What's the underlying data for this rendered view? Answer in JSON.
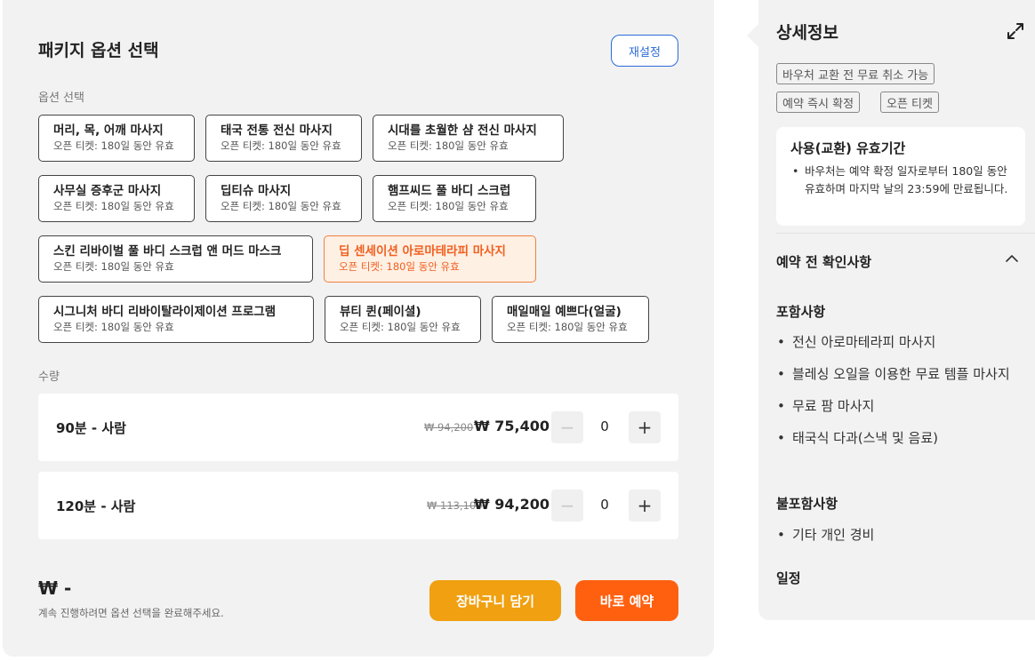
{
  "package": {
    "title": "패키지 옵션 선택",
    "reset_label": "재설정",
    "options_label": "옵션 선택",
    "options": [
      {
        "name": "머리, 목, 어깨 마사지",
        "sub": "오픈 티켓: 180일 동안 유효",
        "selected": false
      },
      {
        "name": "태국 전통 전신 마사지",
        "sub": "오픈 티켓: 180일 동안 유효",
        "selected": false
      },
      {
        "name": "시대를 초월한 샴 전신 마사지",
        "sub": "오픈 티켓: 180일 동안 유효",
        "selected": false
      },
      {
        "name": "사무실 증후군 마사지",
        "sub": "오픈 티켓: 180일 동안 유효",
        "selected": false
      },
      {
        "name": "딥티슈 마사지",
        "sub": "오픈 티켓: 180일 동안 유효",
        "selected": false
      },
      {
        "name": "햄프씨드 풀 바디 스크럽",
        "sub": "오픈 티켓: 180일 동안 유효",
        "selected": false
      },
      {
        "name": "스킨 리바이벌 풀 바디 스크럽 앤 머드 마스크",
        "sub": "오픈 티켓: 180일 동안 유효",
        "selected": false
      },
      {
        "name": "딥 센세이션 아로마테라피 마사지",
        "sub": "오픈 티켓: 180일 동안 유효",
        "selected": true
      },
      {
        "name": "시그니처 바디 리바이탈라이제이션 프로그램",
        "sub": "오픈 티켓: 180일 동안 유효",
        "selected": false
      },
      {
        "name": "뷰티 퀸(페이셜)",
        "sub": "오픈 티켓: 180일 동안 유효",
        "selected": false
      },
      {
        "name": "매일매일 예쁘다(얼굴)",
        "sub": "오픈 티켓: 180일 동안 유효",
        "selected": false
      }
    ],
    "quantity_label": "수량",
    "quantities": [
      {
        "label": "90분 - 사람",
        "original_price": "₩ 94,200",
        "price": "₩ 75,400",
        "qty": "0"
      },
      {
        "label": "120분 - 사람",
        "original_price": "₩ 113,100",
        "price": "₩ 94,200",
        "qty": "0"
      }
    ],
    "total": "₩ -",
    "hint": "계속 진행하려면 옵션 선택을 완료해주세요.",
    "cart_label": "장바구니 담기",
    "book_label": "바로 예약",
    "colors": {
      "accent_blue": "#2a6bd8",
      "selected_orange": "#f06020",
      "cart": "#f0a010",
      "book": "#ff6010"
    }
  },
  "details": {
    "title": "상세정보",
    "expand_icon": "expand-icon",
    "tags": [
      "바우처 교환 전 무료 취소 가능",
      "예약 즉시 확정",
      "오픈 티켓"
    ],
    "validity": {
      "title": "사용(교환) 유효기간",
      "items": [
        "바우처는 예약 확정 일자로부터 180일 동안 유효하며 마지막 날의 23:59에 만료됩니다."
      ]
    },
    "accordion_title": "예약 전 확인사항",
    "included_title": "포함사항",
    "included": [
      "전신 아로마테라피 마사지",
      "블레싱 오일을 이용한 무료 템플 마사지",
      "무료 팜 마사지",
      "태국식 다과(스낵 및 음료)"
    ],
    "excluded_title": "불포함사항",
    "excluded": [
      "기타 개인 경비"
    ],
    "schedule_title": "일정"
  }
}
